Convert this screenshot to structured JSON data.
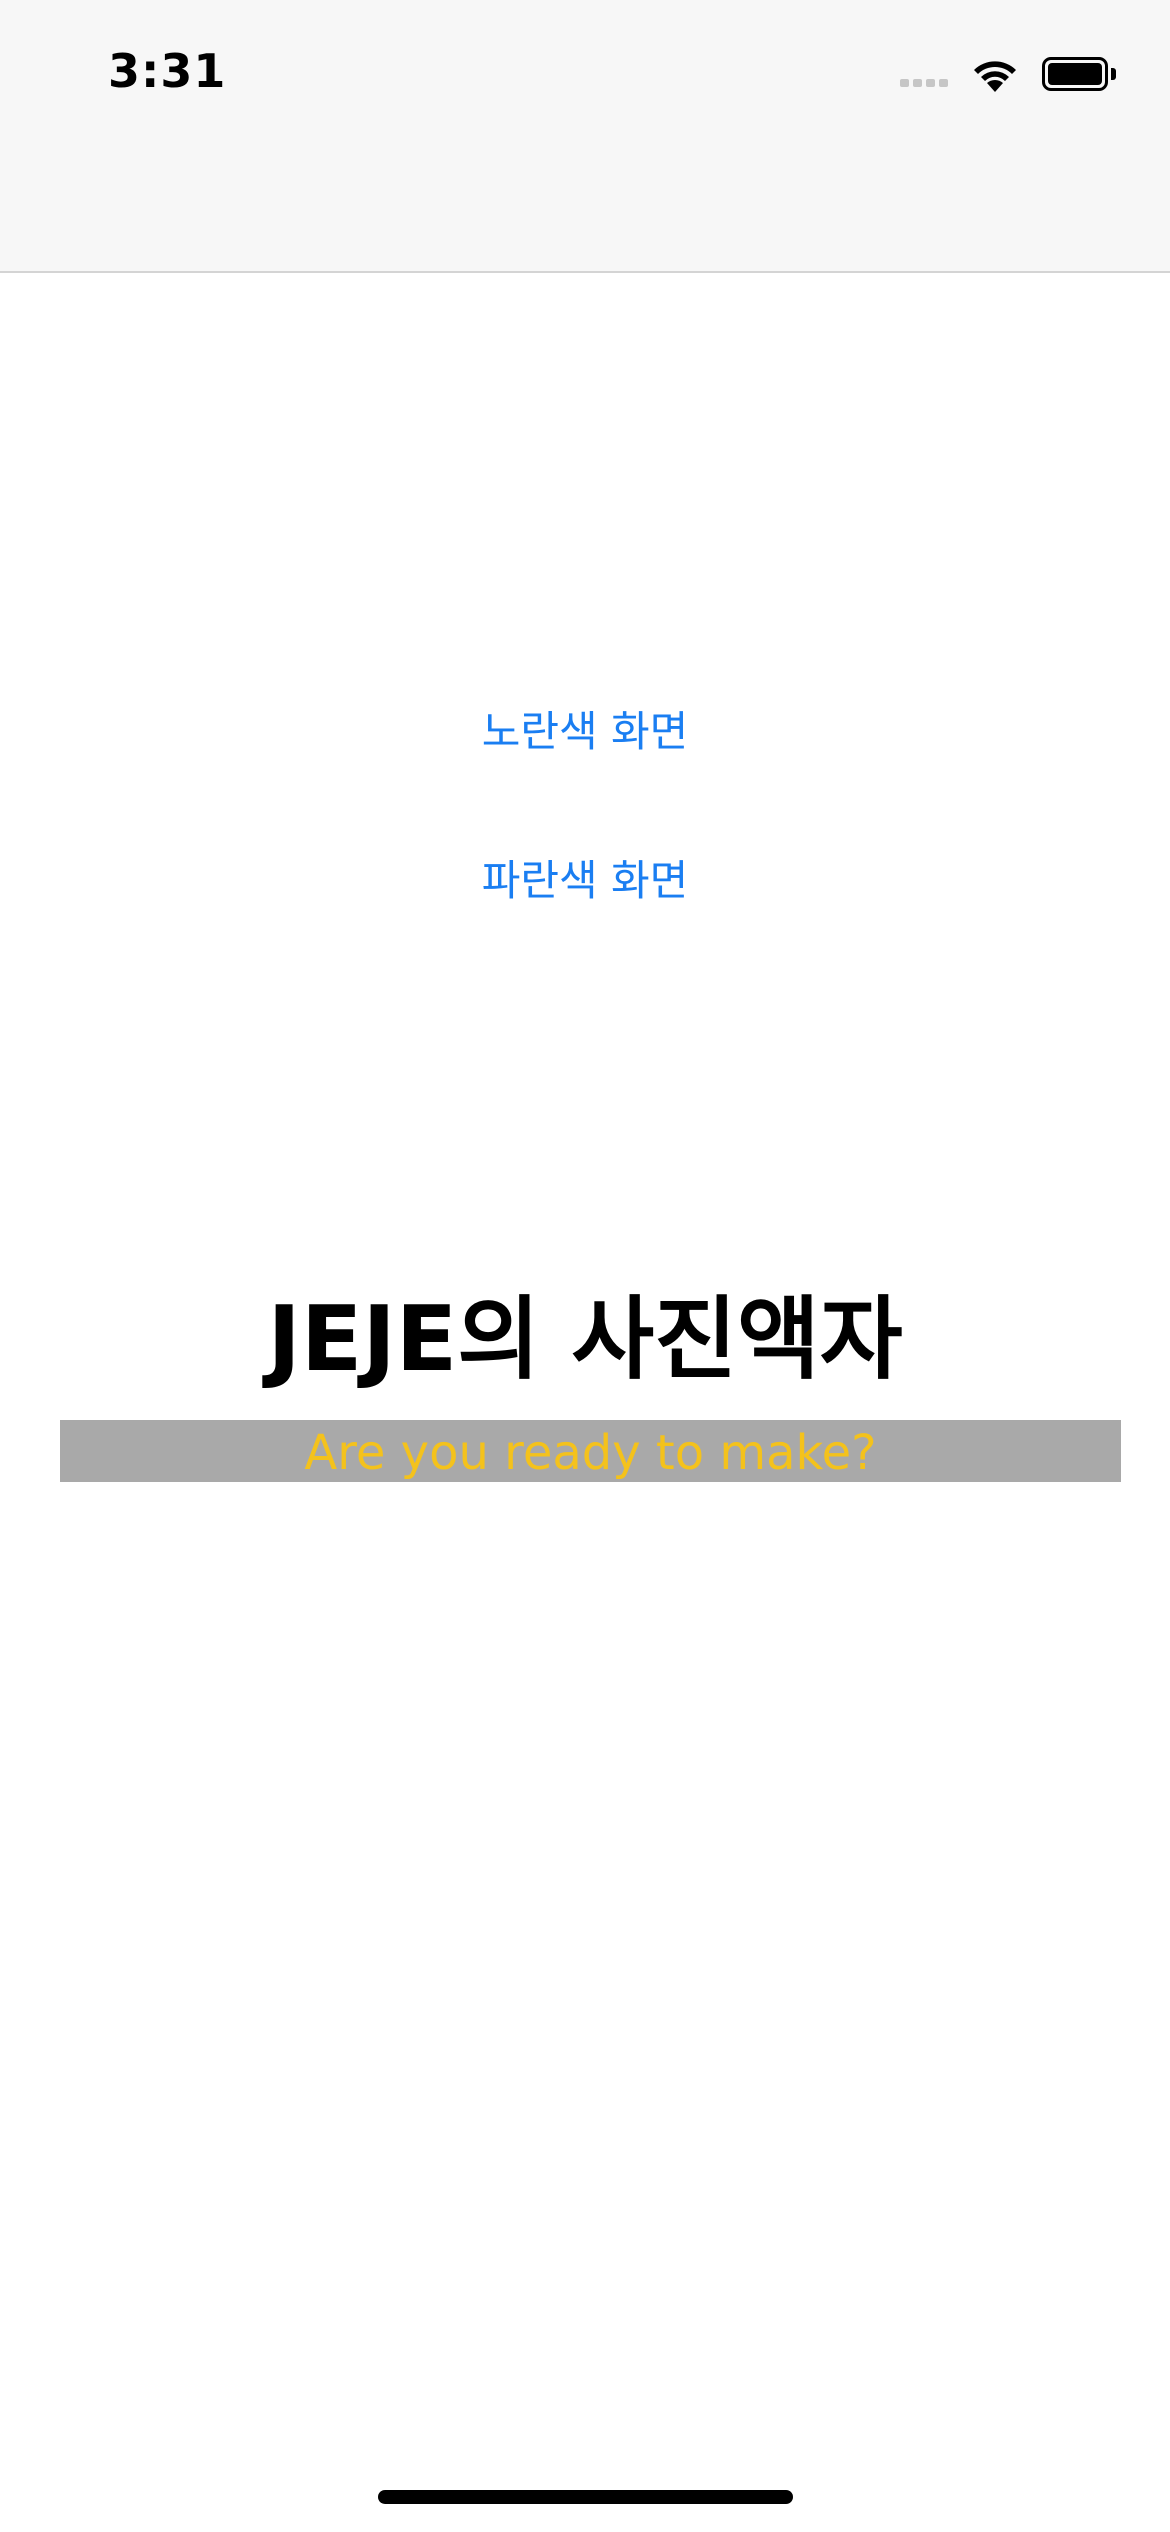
{
  "status_bar": {
    "time": "3:31",
    "icons": [
      "cellular-signal-icon",
      "wifi-icon",
      "battery-icon"
    ]
  },
  "buttons": {
    "yellow_screen": "노란색 화면",
    "blue_screen": "파란색 화면"
  },
  "main": {
    "title": "JEJE의 사진액자",
    "subtitle": "Are you ready to make?"
  },
  "colors": {
    "link": "#1a7ef2",
    "subtitle_text": "#f4c21c",
    "subtitle_background": "#a9a9a9",
    "nav_background": "#f7f7f7"
  }
}
